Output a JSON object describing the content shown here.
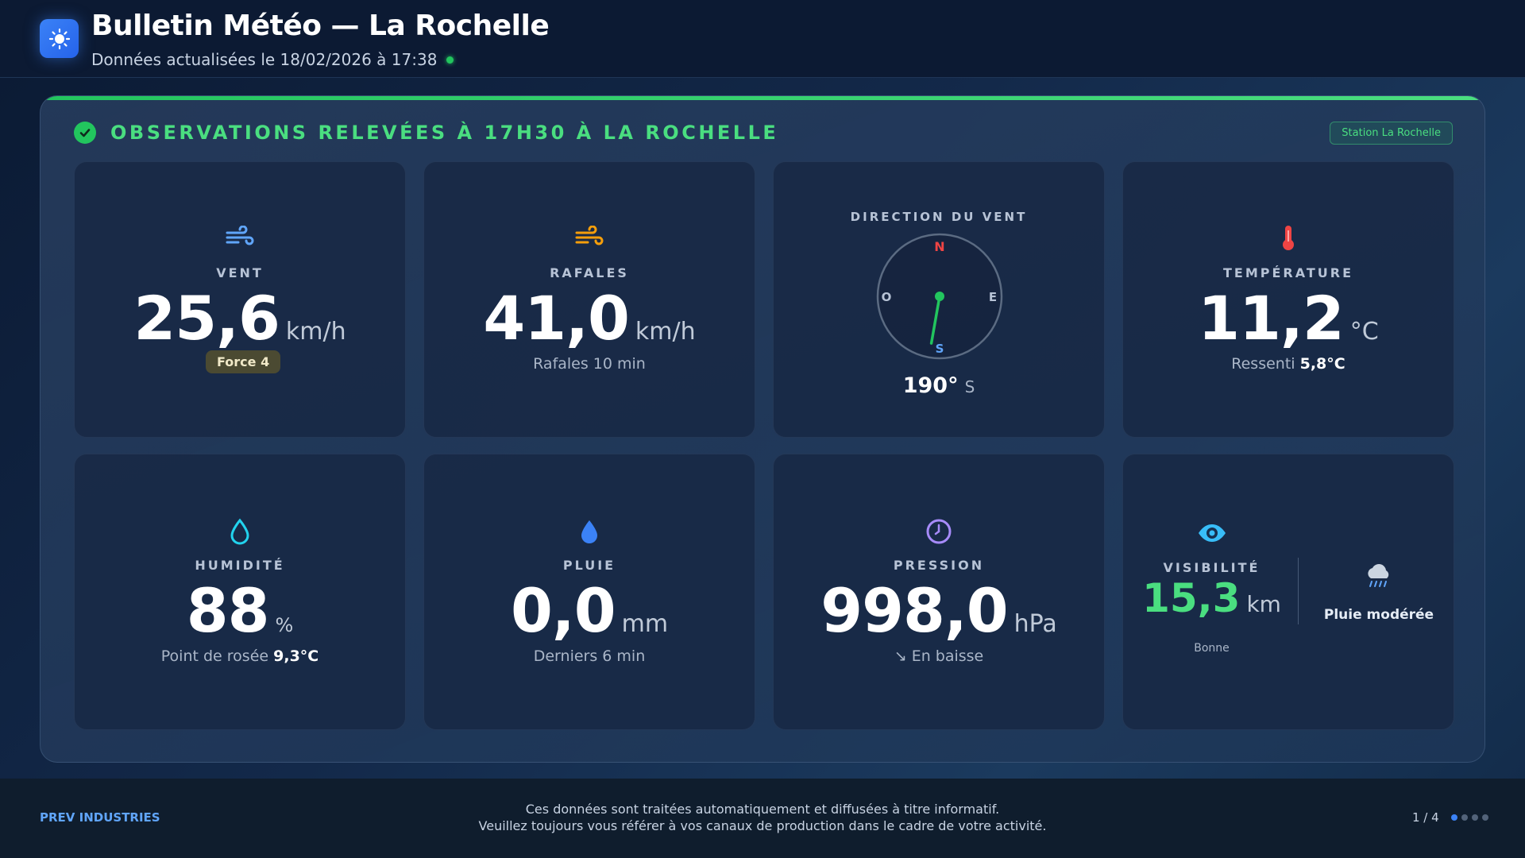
{
  "header": {
    "title": "Bulletin Météo — La Rochelle",
    "subtitle": "Données actualisées le 18/02/2026 à 17:38",
    "app_icon": "sun-icon",
    "live_color": "#22c55e"
  },
  "panel": {
    "heading": "OBSERVATIONS RELEVÉES À 17H30 À LA ROCHELLE",
    "station": "Station La Rochelle",
    "accent": "#4ade80"
  },
  "cards": {
    "wind": {
      "icon": "wind-icon",
      "label": "VENT",
      "value": "25,6",
      "unit": "km/h",
      "badge": "Force 4"
    },
    "gusts": {
      "icon": "gust-icon",
      "label": "RAFALES",
      "value": "41,0",
      "unit": "km/h",
      "sub": "Rafales 10 min"
    },
    "direction": {
      "label": "DIRECTION DU VENT",
      "value": "190°",
      "cardinal": "S",
      "compass": {
        "n": "N",
        "e": "E",
        "s": "S",
        "o": "O"
      },
      "degrees": 190
    },
    "temperature": {
      "icon": "thermometer-icon",
      "label": "TEMPÉRATURE",
      "value": "11,2",
      "unit": "°C",
      "sub_label": "Ressenti",
      "sub_value": "5,8°C"
    },
    "humidity": {
      "icon": "drop-outline-icon",
      "label": "HUMIDITÉ",
      "value": "88",
      "unit": "%",
      "sub_label": "Point de rosée",
      "sub_value": "9,3°C"
    },
    "rain": {
      "icon": "drop-filled-icon",
      "label": "PLUIE",
      "value": "0,0",
      "unit": "mm",
      "sub": "Derniers 6 min"
    },
    "pressure": {
      "icon": "gauge-icon",
      "label": "PRESSION",
      "value": "998,0",
      "unit": "hPa",
      "sub": "↘ En baisse"
    },
    "visibility": {
      "icon": "eye-icon",
      "label": "VISIBILITÉ",
      "value": "15,3",
      "unit": "km",
      "quality": "Bonne",
      "weather_icon": "rain-cloud-icon",
      "weather": "Pluie modérée"
    }
  },
  "footer": {
    "brand": "PREV INDUSTRIES",
    "line1": "Ces données sont traitées automatiquement et diffusées à titre informatif.",
    "line2": "Veuillez toujours vous référer à vos canaux de production dans le cadre de votre activité.",
    "page": "1 / 4",
    "page_count": 4,
    "current_page": 1
  }
}
